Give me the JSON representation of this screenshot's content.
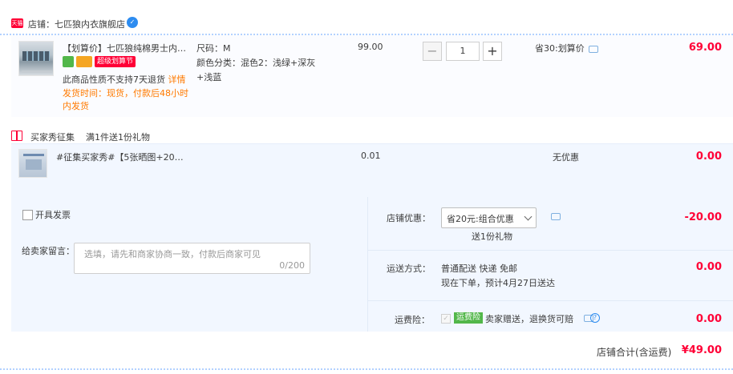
{
  "shop": {
    "badge": "天猫",
    "label": "店铺：",
    "name": "七匹狼内衣旗舰店",
    "ww_icon": "wangwang-icon"
  },
  "items": [
    {
      "title": "【划算价】七匹狼纯棉男士内裤…",
      "promo_tag": "超级划算节",
      "return_note": "此商品性质不支持7天退货",
      "detail_link": "详情",
      "ship_time": "发货时间：现货，付款后48小时内发货",
      "sku_size": "尺码：M",
      "sku_color": "颜色分类：混色2：浅绿+深灰+浅蓝",
      "price": "99.00",
      "quantity": "1",
      "discount": "省30:划算价",
      "total": "69.00"
    },
    {
      "title": "#征集买家秀#【5张晒图+20…",
      "price": "0.01",
      "discount": "无优惠",
      "total": "0.00"
    }
  ],
  "gift": {
    "label": "买家秀征集",
    "desc": "满1件送1份礼物"
  },
  "invoice": {
    "label": "开具发票"
  },
  "message": {
    "label": "给卖家留言：",
    "placeholder": "选填，请先和商家协商一致，付款后商家可见",
    "count": "0/200"
  },
  "shop_coupon": {
    "label": "店铺优惠：",
    "selected": "省20元:组合优惠",
    "gift_note": "送1份礼物",
    "amount": "-20.00"
  },
  "shipping": {
    "label": "运送方式：",
    "method": "普通配送 快递 免邮",
    "eta": "现在下单，预计4月27日送达",
    "fee": "0.00"
  },
  "insurance": {
    "label": "运费险：",
    "tag": "运费险",
    "desc": "卖家赠送，退换货可赔",
    "fee": "0.00"
  },
  "total": {
    "label": "店铺合计(含运费)",
    "value": "¥49.00"
  },
  "colors": {
    "accent_red": "#ff0036",
    "link_orange": "#ff7a00",
    "panel_blue": "#f2f7ff",
    "insurance_green": "#52b74a"
  }
}
